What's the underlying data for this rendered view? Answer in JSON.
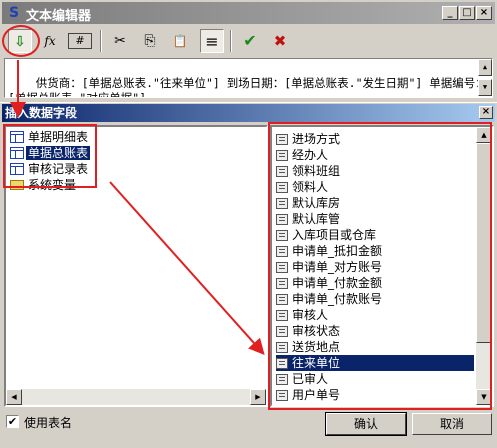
{
  "window": {
    "title": "文本编辑器",
    "controls": {
      "minimize": "_",
      "maximize": "□",
      "close": "×"
    }
  },
  "toolbar": {
    "items": [
      {
        "icon": "insert-field-icon",
        "glyph": "⇩"
      },
      {
        "icon": "function-icon",
        "glyph": "fx"
      },
      {
        "icon": "number-format-icon",
        "glyph": "#"
      },
      {
        "icon": "cut-icon",
        "glyph": "✂"
      },
      {
        "icon": "copy-icon",
        "glyph": "⎘"
      },
      {
        "icon": "paste-icon",
        "glyph": "📋"
      },
      {
        "icon": "align-icon",
        "glyph": "≡"
      },
      {
        "icon": "confirm-check-icon",
        "glyph": "✔",
        "color": "#1a8a1a"
      },
      {
        "icon": "cancel-x-icon",
        "glyph": "✖",
        "color": "#c01010"
      }
    ]
  },
  "editor": {
    "text": "供货商：[单据总账表.\"往来单位\"] 到场日期：[单据总账表.\"发生日期\"] 单据编号：[单据总账表.\"对应单据\"]"
  },
  "dialog": {
    "title": "插入数据字段",
    "tables": [
      {
        "label": "单据明细表",
        "icon": "table-icon",
        "selected": false
      },
      {
        "label": "单据总账表",
        "icon": "table-icon",
        "selected": true
      },
      {
        "label": "审核记录表",
        "icon": "table-icon",
        "selected": false
      },
      {
        "label": "系统变量",
        "icon": "folder-icon",
        "selected": false
      }
    ],
    "fields": [
      {
        "label": "进场方式",
        "selected": false
      },
      {
        "label": "经办人",
        "selected": false
      },
      {
        "label": "领料班组",
        "selected": false
      },
      {
        "label": "领料人",
        "selected": false
      },
      {
        "label": "默认库房",
        "selected": false
      },
      {
        "label": "默认库管",
        "selected": false
      },
      {
        "label": "入库项目或仓库",
        "selected": false
      },
      {
        "label": "申请单_抵扣金额",
        "selected": false
      },
      {
        "label": "申请单_对方账号",
        "selected": false
      },
      {
        "label": "申请单_付款金额",
        "selected": false
      },
      {
        "label": "申请单_付款账号",
        "selected": false
      },
      {
        "label": "审核人",
        "selected": false
      },
      {
        "label": "审核状态",
        "selected": false
      },
      {
        "label": "送货地点",
        "selected": false
      },
      {
        "label": "往来单位",
        "selected": true
      },
      {
        "label": "已审人",
        "selected": false
      },
      {
        "label": "用户单号",
        "selected": false
      }
    ],
    "use_table_name": {
      "label": "使用表名",
      "checked": true
    },
    "ok_label": "确认",
    "cancel_label": "取消"
  },
  "colors": {
    "selection": "#0a246a",
    "annotation": "#e02020"
  }
}
